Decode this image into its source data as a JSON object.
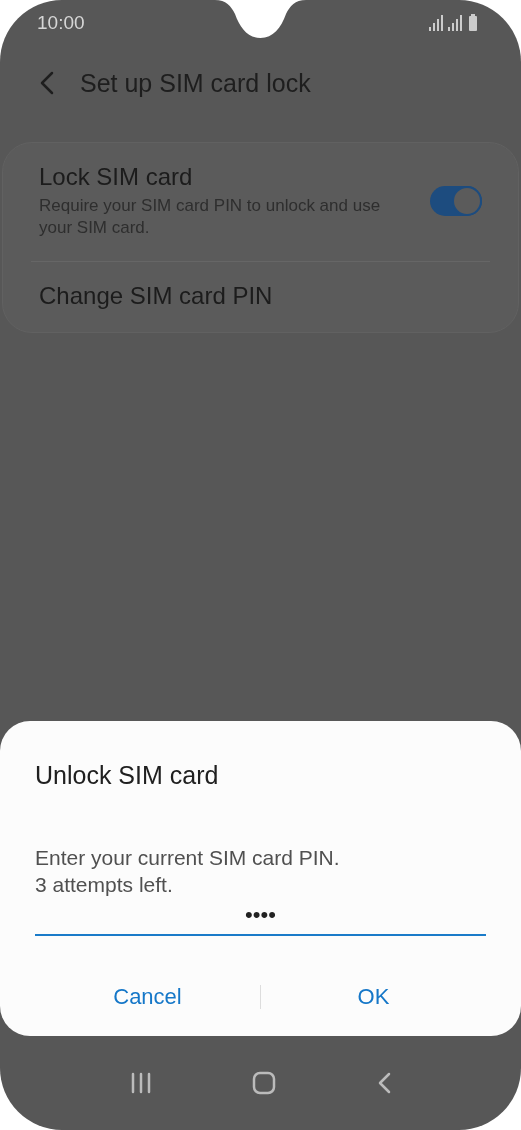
{
  "status_bar": {
    "time": "10:00"
  },
  "header": {
    "title": "Set up SIM card lock"
  },
  "settings": [
    {
      "kind": "toggle",
      "title": "Lock SIM card",
      "subtitle": "Require your SIM card PIN to unlock and use your SIM card.",
      "on": true
    },
    {
      "kind": "link",
      "title": "Change SIM card PIN"
    }
  ],
  "dialog": {
    "title": "Unlock SIM card",
    "message": [
      "Enter your current SIM card PIN.",
      "3 attempts left."
    ],
    "pin_field": {
      "value": "••••"
    },
    "buttons": [
      "Cancel",
      "OK"
    ]
  }
}
